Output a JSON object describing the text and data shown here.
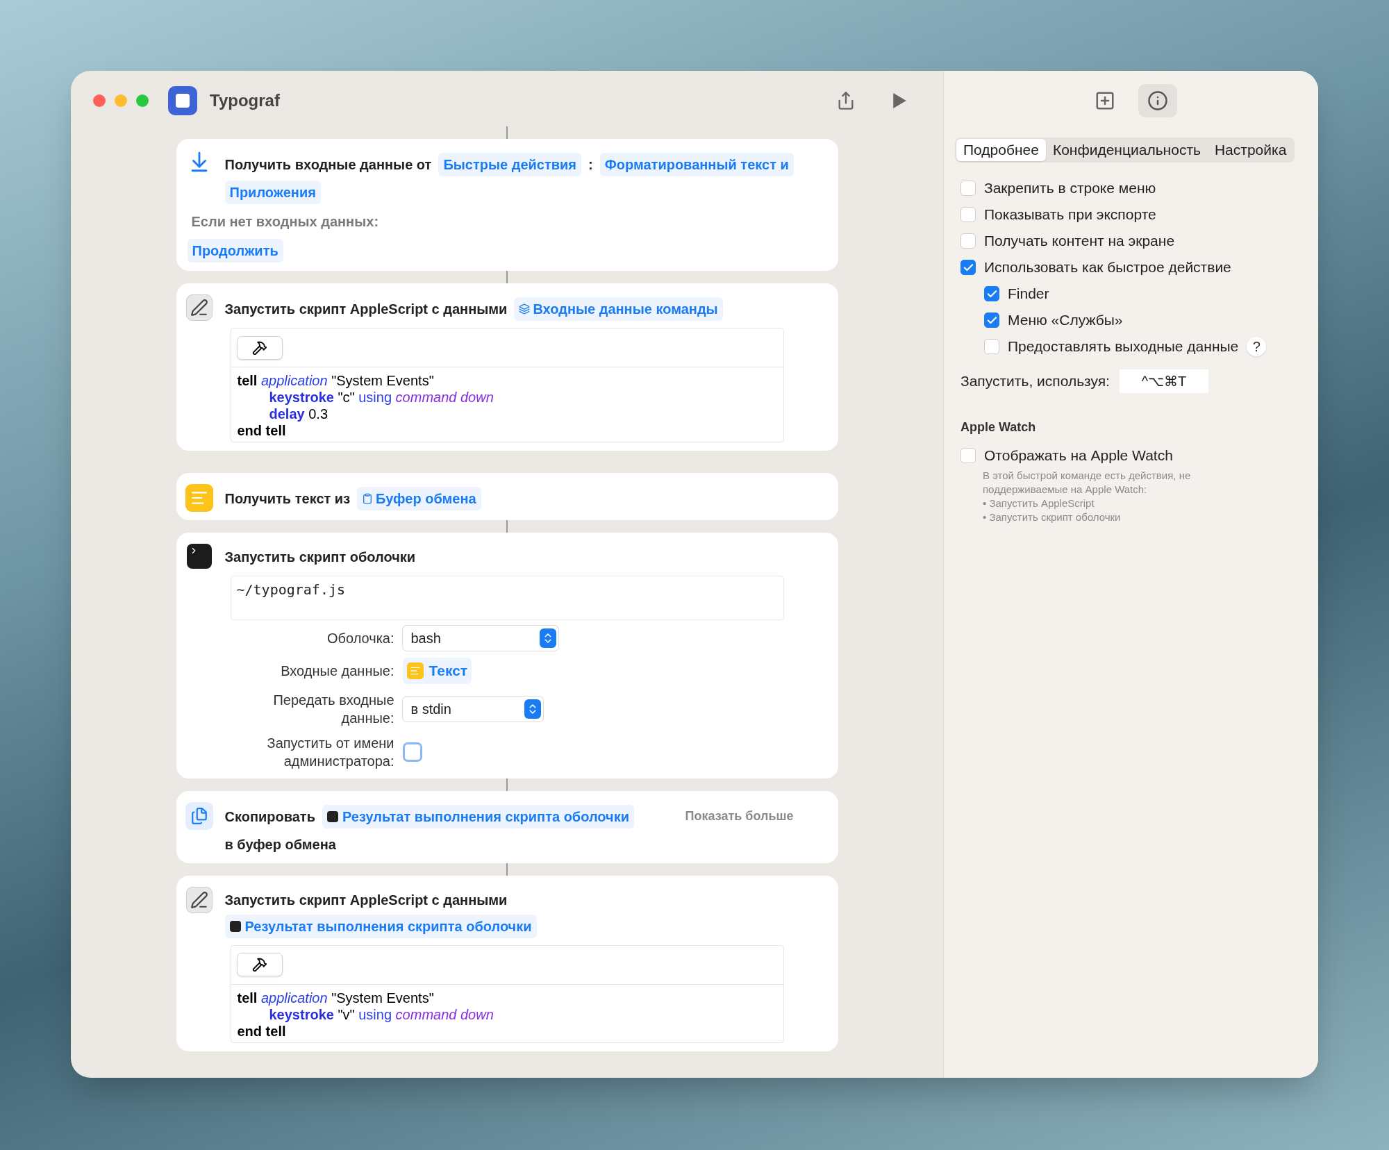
{
  "window": {
    "title": "Typograf"
  },
  "actions": [
    {
      "kind": "receive",
      "linked": true,
      "segments": [
        {
          "kind": "text",
          "text": "Получить входные данные от"
        },
        {
          "kind": "variable",
          "text": "Быстрые действия"
        },
        {
          "kind": "text",
          "text": ":"
        },
        {
          "kind": "variable",
          "text": "Форматированный текст и"
        },
        {
          "kind": "variable",
          "text": "Приложения"
        }
      ],
      "fallback_label": "Если нет входных данных:",
      "fallback_value": "Продолжить"
    },
    {
      "kind": "applescript",
      "linked": true,
      "segments": [
        {
          "kind": "text",
          "text": "Запустить скрипт AppleScript с данными"
        },
        {
          "kind": "shortcut_input",
          "text": "Входные данные команды"
        }
      ],
      "code": [
        {
          "tokens": [
            {
              "kind": "command",
              "text": "tell"
            },
            {
              "kind": "class",
              "text": "application"
            },
            {
              "kind": "plain",
              "text": "\"System Events\""
            }
          ],
          "children": [
            {
              "tokens": [
                {
                  "kind": "event",
                  "text": "keystroke"
                },
                {
                  "kind": "plain",
                  "text": "\"c\""
                },
                {
                  "kind": "keyword",
                  "text": "using"
                },
                {
                  "kind": "param",
                  "text": "command down"
                }
              ]
            },
            {
              "tokens": [
                {
                  "kind": "event",
                  "text": "delay"
                },
                {
                  "kind": "plain",
                  "text": "0.3"
                }
              ]
            }
          ]
        },
        {
          "tokens": [
            {
              "kind": "command",
              "text": "end tell"
            }
          ]
        }
      ]
    },
    {
      "kind": "get_text",
      "linked": false,
      "segments": [
        {
          "kind": "text",
          "text": "Получить текст из"
        },
        {
          "kind": "clipboard",
          "text": "Буфер обмена"
        }
      ]
    },
    {
      "kind": "shell",
      "linked": true,
      "segments": [
        {
          "kind": "text",
          "text": "Запустить скрипт оболочки"
        }
      ],
      "script": "~/typograf.js",
      "fields": [
        {
          "kind": "select",
          "label": "Оболочка:",
          "value": "bash"
        },
        {
          "kind": "variable",
          "label": "Входные данные:",
          "value": "Текст"
        },
        {
          "kind": "select",
          "label": "Передать входные данные:",
          "value": "в stdin"
        },
        {
          "kind": "checkbox",
          "label": "Запустить от имени администратора:",
          "checked": false
        }
      ]
    },
    {
      "kind": "copy",
      "linked": true,
      "segments": [
        {
          "kind": "text",
          "text": "Скопировать"
        },
        {
          "kind": "shell_result",
          "text": "Результат выполнения скрипта оболочки"
        },
        {
          "kind": "more",
          "text": "Показать больше"
        },
        {
          "kind": "text",
          "text": "в буфер обмена"
        }
      ]
    },
    {
      "kind": "applescript",
      "linked": true,
      "segments": [
        {
          "kind": "text",
          "text": "Запустить скрипт AppleScript с данными"
        },
        {
          "kind": "shell_result",
          "text": "Результат выполнения скрипта оболочки"
        }
      ],
      "code": [
        {
          "tokens": [
            {
              "kind": "command",
              "text": "tell"
            },
            {
              "kind": "class",
              "text": "application"
            },
            {
              "kind": "plain",
              "text": "\"System Events\""
            }
          ],
          "children": [
            {
              "tokens": [
                {
                  "kind": "event",
                  "text": "keystroke"
                },
                {
                  "kind": "plain",
                  "text": "\"v\""
                },
                {
                  "kind": "keyword",
                  "text": "using"
                },
                {
                  "kind": "param",
                  "text": "command down"
                }
              ]
            }
          ]
        },
        {
          "tokens": [
            {
              "kind": "command",
              "text": "end tell"
            }
          ]
        }
      ]
    }
  ],
  "inspector": {
    "tabs": [
      {
        "label": "Подробнее",
        "selected": true
      },
      {
        "label": "Конфиденциальность",
        "selected": false
      },
      {
        "label": "Настройка",
        "selected": false
      }
    ],
    "options": [
      {
        "label": "Закрепить в строке меню",
        "checked": false
      },
      {
        "label": "Показывать при экспорте",
        "checked": false
      },
      {
        "label": "Получать контент на экране",
        "checked": false
      },
      {
        "label": "Использовать как быстрое действие",
        "checked": true,
        "children": [
          {
            "label": "Finder",
            "checked": true
          },
          {
            "label": "Меню «Службы»",
            "checked": true
          },
          {
            "label": "Предоставлять выходные данные",
            "checked": false,
            "help": "?"
          }
        ]
      }
    ],
    "shortcut": {
      "label": "Запустить, используя:",
      "value": "^⌥⌘T"
    },
    "watch": {
      "heading": "Apple Watch",
      "option": {
        "label": "Отображать на Apple Watch",
        "checked": false
      },
      "note": "В этой быстрой команде есть действия, не поддерживаемые на Apple Watch:",
      "items": [
        "• Запустить AppleScript",
        "• Запустить скрипт оболочки"
      ]
    }
  }
}
